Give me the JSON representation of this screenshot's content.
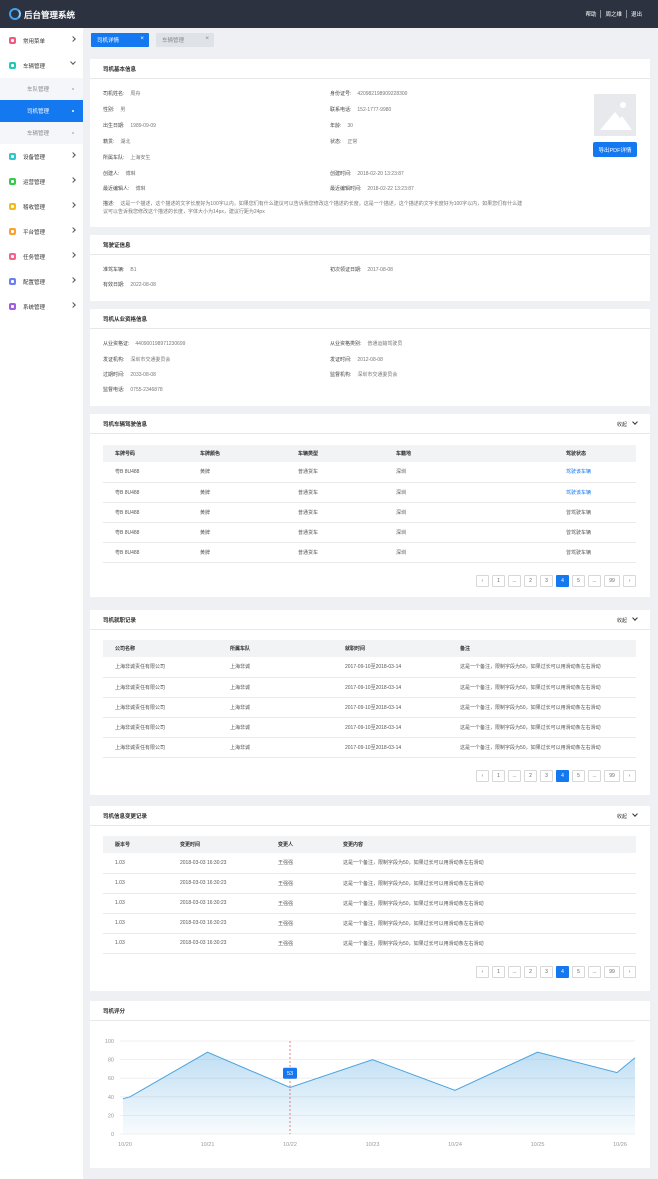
{
  "app": {
    "title": "后台管理系统",
    "links": [
      "帮助",
      "周之维",
      "退出"
    ]
  },
  "sidebar": {
    "items": [
      {
        "label": "常用菜单",
        "color": "#f25a7c"
      },
      {
        "label": "车辆管理",
        "color": "#23c9b4",
        "expanded": true,
        "children": [
          {
            "label": "车队管理"
          },
          {
            "label": "司机管理",
            "active": true
          },
          {
            "label": "车辆管理"
          }
        ]
      },
      {
        "label": "设备管理",
        "color": "#2ec7c9"
      },
      {
        "label": "运营管理",
        "color": "#37c94d"
      },
      {
        "label": "稽收管理",
        "color": "#f5b918"
      },
      {
        "label": "平台管理",
        "color": "#f7a233"
      },
      {
        "label": "任务管理",
        "color": "#f2648b"
      },
      {
        "label": "配置管理",
        "color": "#6b7ff2"
      },
      {
        "label": "系统管理",
        "color": "#a25ce0"
      }
    ]
  },
  "tabs": [
    {
      "label": "司机详情",
      "active": true
    },
    {
      "label": "车辆管理",
      "active": false
    }
  ],
  "basic": {
    "title": "司机基本信息",
    "left": [
      {
        "label": "司机姓名:",
        "value": "周舟"
      },
      {
        "label": "性别:",
        "value": "男"
      },
      {
        "label": "出生日期:",
        "value": "1989-09-09"
      },
      {
        "label": "籍贯:",
        "value": "湖北"
      },
      {
        "label": "所属车队:",
        "value": "上海安生"
      },
      {
        "label": "创建人:",
        "value": "博琳"
      },
      {
        "label": "最近编辑人:",
        "value": "博琳"
      }
    ],
    "right": [
      {
        "label": "身份证号:",
        "value": "420982198909228300"
      },
      {
        "label": "联系电话:",
        "value": "152-1777-9980"
      },
      {
        "label": "年龄:",
        "value": "30"
      },
      {
        "label": "状态:",
        "value": "正常"
      },
      {
        "label": "创建时间:",
        "value": "2018-02-20 13:23:87"
      },
      {
        "label": "最近编辑时间:",
        "value": "2018-02-22 13:23:87"
      }
    ],
    "remark_label": "描述:",
    "remark": "这是一个描述，这个描述的文字长度好为100字以内，如果您们有什么建议可以告诉我您修改这个描述的长度。这是一个描述，这个描述的文字长度好为100字以内，如果您们有什么建议可以告诉我您修改这个描述的长度，字体大小为14px，建议行距为24px",
    "export_button": "导出PDF详情"
  },
  "license": {
    "title": "驾驶证信息",
    "items": [
      {
        "label": "准驾车辆:",
        "value": "B1"
      },
      {
        "label": "初次领证日期:",
        "value": "2017-08-08"
      },
      {
        "label": "有效日期:",
        "value": "2022-08-08"
      }
    ]
  },
  "qualification": {
    "title": "司机从业资格信息",
    "items": [
      {
        "label": "从业资格证:",
        "value": "440900198971230699"
      },
      {
        "label": "从业资格类别:",
        "value": "普通运输驾驶员"
      },
      {
        "label": "发证机构:",
        "value": "深圳市交通委员会"
      },
      {
        "label": "发证时间:",
        "value": "2012-08-08"
      },
      {
        "label": "过期时间:",
        "value": "2033-08-08"
      },
      {
        "label": "监督机构:",
        "value": "深圳市交通委员会"
      },
      {
        "label": "监督电话:",
        "value": "0755-2346878"
      }
    ]
  },
  "vehicles": {
    "title": "司机车辆驾驶信息",
    "collapse": "收起",
    "headers": [
      "车牌号码",
      "车牌颜色",
      "车辆类型",
      "车籍地",
      "驾驶状态"
    ],
    "rows": [
      [
        "粤B 8U488",
        "黄牌",
        "普通货车",
        "深圳",
        "驾驶该车辆"
      ],
      [
        "粤B 8U488",
        "黄牌",
        "普通货车",
        "深圳",
        "驾驶该车辆"
      ],
      [
        "粤B 8U488",
        "黄牌",
        "普通货车",
        "深圳",
        "曾驾驶车辆"
      ],
      [
        "粤B 8U488",
        "黄牌",
        "普通货车",
        "深圳",
        "曾驾驶车辆"
      ],
      [
        "粤B 8U488",
        "黄牌",
        "普通货车",
        "深圳",
        "曾驾驶车辆"
      ]
    ]
  },
  "employment": {
    "title": "司机就职记录",
    "collapse": "收起",
    "headers": [
      "公司名称",
      "所属车队",
      "就职时间",
      "备注"
    ],
    "rows": [
      [
        "上海非诚责任有限公司",
        "上海非诚",
        "2017-09-10至2018-03-14",
        "这是一个备注，限制字段为50，如果过长可以用滑动条左右滑动"
      ],
      [
        "上海非诚责任有限公司",
        "上海非诚",
        "2017-09-10至2018-03-14",
        "这是一个备注，限制字段为50，如果过长可以用滑动条左右滑动"
      ],
      [
        "上海非诚责任有限公司",
        "上海非诚",
        "2017-09-10至2018-03-14",
        "这是一个备注，限制字段为50，如果过长可以用滑动条左右滑动"
      ],
      [
        "上海非诚责任有限公司",
        "上海非诚",
        "2017-09-10至2018-03-14",
        "这是一个备注，限制字段为50，如果过长可以用滑动条左右滑动"
      ],
      [
        "上海非诚责任有限公司",
        "上海非诚",
        "2017-09-10至2018-03-14",
        "这是一个备注，限制字段为50，如果过长可以用滑动条左右滑动"
      ]
    ]
  },
  "changes": {
    "title": "司机信息变更记录",
    "collapse": "收起",
    "headers": [
      "版本号",
      "变更时间",
      "变更人",
      "变更内容"
    ],
    "rows": [
      [
        "1.03",
        "2018-03-03 16:30:23",
        "王强强",
        "这是一个备注，限制字段为50，如果过长可以用滑动条左右滑动"
      ],
      [
        "1.03",
        "2018-03-03 16:30:23",
        "王强强",
        "这是一个备注，限制字段为50，如果过长可以用滑动条左右滑动"
      ],
      [
        "1.03",
        "2018-03-03 16:30:23",
        "王强强",
        "这是一个备注，限制字段为50，如果过长可以用滑动条左右滑动"
      ],
      [
        "1.03",
        "2018-03-03 16:30:23",
        "王强强",
        "这是一个备注，限制字段为50，如果过长可以用滑动条左右滑动"
      ],
      [
        "1.03",
        "2018-03-03 16:30:23",
        "王强强",
        "这是一个备注，限制字段为50，如果过长可以用滑动条左右滑动"
      ]
    ]
  },
  "pager": {
    "items": [
      "‹",
      "1",
      "...",
      "2",
      "3",
      "4",
      "5",
      "...",
      "99",
      "›"
    ],
    "current": "4"
  },
  "rating": {
    "title": "司机评分",
    "tooltip": "53"
  },
  "chart_data": {
    "type": "area",
    "x": [
      "10/20",
      "10/21",
      "10/22",
      "10/23",
      "10/24",
      "10/25",
      "10/26"
    ],
    "points": [
      {
        "x": "10/20",
        "y": 38
      },
      {
        "x": "10/20",
        "y": 40
      },
      {
        "x": "10/21",
        "y": 88
      },
      {
        "x": "10/22",
        "y": 50
      },
      {
        "x": "10/23",
        "y": 80
      },
      {
        "x": "10/24",
        "y": 47
      },
      {
        "x": "10/25",
        "y": 88
      },
      {
        "x": "10/26",
        "y": 66
      },
      {
        "x": "10/26",
        "y": 82
      }
    ],
    "highlight": {
      "x": "10/22",
      "value": 53
    },
    "ylim": [
      0,
      100
    ],
    "yticks": [
      0,
      20,
      40,
      60,
      80,
      100
    ],
    "color": "#4aa3df"
  }
}
